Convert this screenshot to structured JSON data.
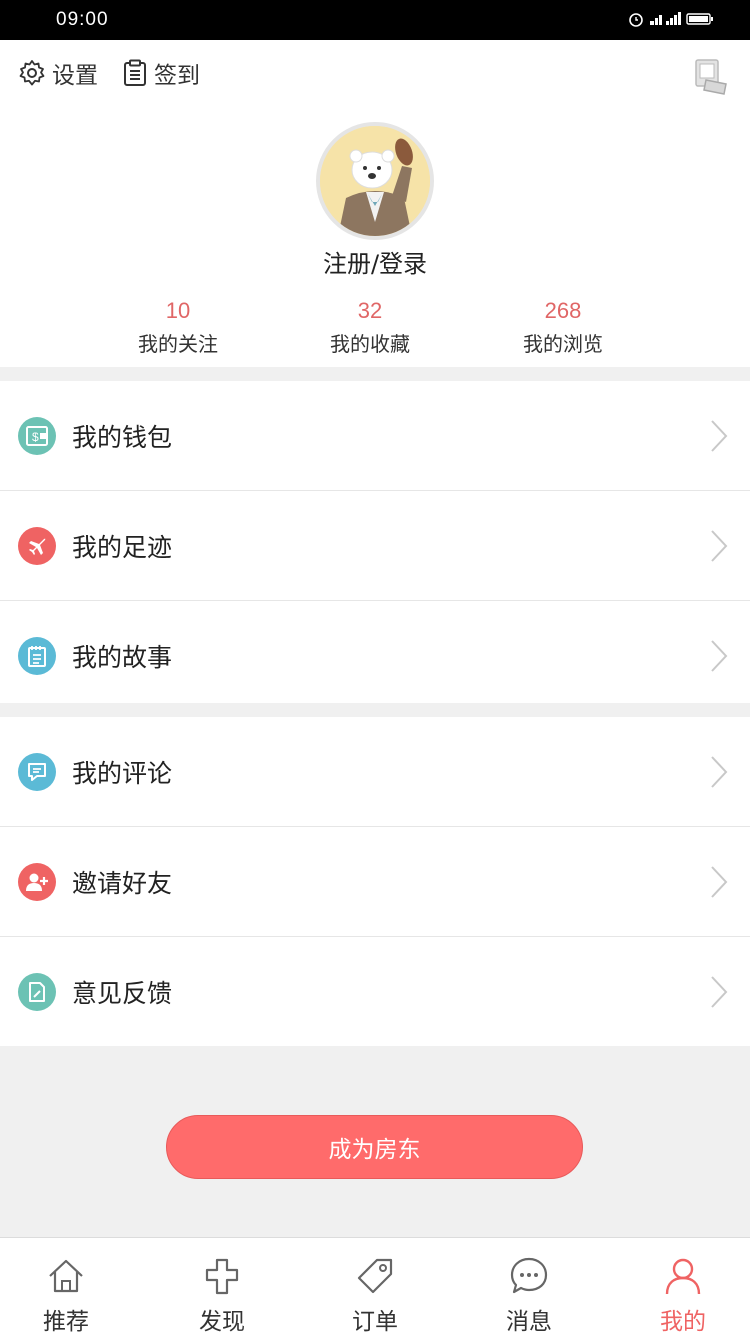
{
  "status_bar": {
    "time": "09:00"
  },
  "header": {
    "settings_label": "设置",
    "checkin_label": "签到",
    "login_label": "注册/登录"
  },
  "stats": [
    {
      "value": "10",
      "label": "我的关注"
    },
    {
      "value": "32",
      "label": "我的收藏"
    },
    {
      "value": "268",
      "label": "我的浏览"
    }
  ],
  "menu_group_1": [
    {
      "label": "我的钱包",
      "icon": "wallet-icon",
      "color": "#6cc2b4"
    },
    {
      "label": "我的足迹",
      "icon": "airplane-icon",
      "color": "#ef6363"
    },
    {
      "label": "我的故事",
      "icon": "notebook-icon",
      "color": "#5bbad6"
    }
  ],
  "menu_group_2": [
    {
      "label": "我的评论",
      "icon": "comment-icon",
      "color": "#5bbad6"
    },
    {
      "label": "邀请好友",
      "icon": "add-user-icon",
      "color": "#ef6363"
    },
    {
      "label": "意见反馈",
      "icon": "feedback-icon",
      "color": "#6cc2b4"
    }
  ],
  "landlord_button": "成为房东",
  "tabs": [
    {
      "label": "推荐",
      "icon": "house-icon"
    },
    {
      "label": "发现",
      "icon": "cross-icon"
    },
    {
      "label": "订单",
      "icon": "tag-icon"
    },
    {
      "label": "消息",
      "icon": "chat-bubble-icon"
    },
    {
      "label": "我的",
      "icon": "person-icon",
      "active": true
    }
  ],
  "colors": {
    "accent": "#ff6b6b",
    "stat_number": "#e06666",
    "active_tab": "#ef6363"
  }
}
